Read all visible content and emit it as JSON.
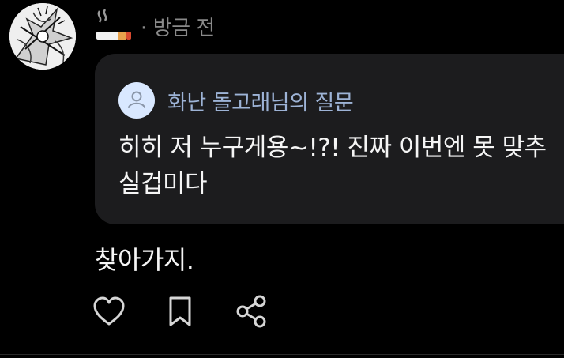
{
  "header": {
    "emoji_icon": "cigarette-emoji",
    "separator": "·",
    "timestamp": "방금 전"
  },
  "question": {
    "asker_name": "화난 돌고래님의 질문",
    "text": "히히 저 누구게용~!?! 진짜 이번엔 못 맞추실겁미다"
  },
  "answer": {
    "text": "찾아가지."
  },
  "actions": [
    {
      "icon": "heart-icon"
    },
    {
      "icon": "bookmark-icon"
    },
    {
      "icon": "share-icon"
    }
  ],
  "colors": {
    "background": "#000000",
    "card": "#1c1c1e",
    "muted_text": "#8a8a8a",
    "asker_name": "#9db3d6",
    "asker_avatar_bg": "#d9e8ff",
    "icon_stroke": "#d6d6d6"
  }
}
